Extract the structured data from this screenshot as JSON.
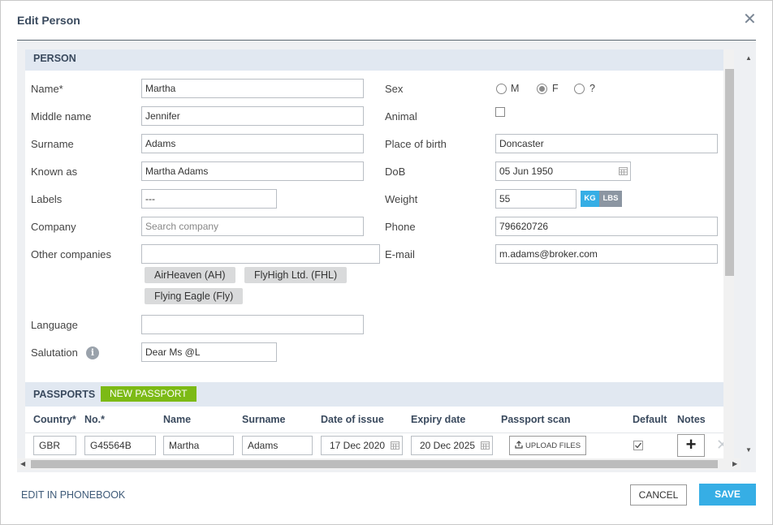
{
  "dialog": {
    "title": "Edit Person",
    "close_glyph": "✕"
  },
  "person": {
    "section_title": "PERSON",
    "name": {
      "label": "Name*",
      "value": "Martha"
    },
    "middle_name": {
      "label": "Middle name",
      "value": "Jennifer"
    },
    "surname": {
      "label": "Surname",
      "value": "Adams"
    },
    "known_as": {
      "label": "Known as",
      "value": "Martha Adams"
    },
    "labels": {
      "label": "Labels",
      "value": "---"
    },
    "company": {
      "label": "Company",
      "placeholder": "Search company"
    },
    "other_companies": {
      "label": "Other companies",
      "value": "",
      "tags": [
        "AirHeaven (AH)",
        "FlyHigh Ltd. (FHL)",
        "Flying Eagle (Fly)"
      ]
    },
    "language": {
      "label": "Language",
      "value": ""
    },
    "salutation": {
      "label": "Salutation",
      "value": "Dear Ms @L",
      "info_icon": "i"
    },
    "sex": {
      "label": "Sex",
      "options": [
        "M",
        "F",
        "?"
      ],
      "selected": "F"
    },
    "animal": {
      "label": "Animal",
      "checked": false
    },
    "place_of_birth": {
      "label": "Place of birth",
      "value": "Doncaster"
    },
    "dob": {
      "label": "DoB",
      "value": "05 Jun 1950"
    },
    "weight": {
      "label": "Weight",
      "value": "55",
      "unit_kg": "KG",
      "unit_lbs": "LBS",
      "selected_unit": "KG"
    },
    "phone": {
      "label": "Phone",
      "value": "796620726"
    },
    "email": {
      "label": "E-mail",
      "value": "m.adams@broker.com"
    }
  },
  "passports": {
    "section_title": "PASSPORTS",
    "new_button": "NEW PASSPORT",
    "columns": [
      "Country*",
      "No.*",
      "Name",
      "Surname",
      "Date of issue",
      "Expiry date",
      "Passport scan",
      "Default",
      "Notes"
    ],
    "rows": [
      {
        "country": "GBR",
        "number": "G45564B",
        "name": "Martha",
        "surname": "Adams",
        "date_of_issue": "17 Dec 2020",
        "expiry_date": "20 Dec 2025",
        "scan_button": "UPLOAD FILES",
        "default": true,
        "notes_button": "+",
        "remove_glyph": "✕"
      }
    ]
  },
  "footer": {
    "edit_link": "EDIT IN PHONEBOOK",
    "cancel": "CANCEL",
    "save": "SAVE"
  },
  "colors": {
    "accent": "#36aee5",
    "new_passport": "#7cba15",
    "section_bg": "#e1e8f1",
    "title": "#3a4a5e"
  }
}
